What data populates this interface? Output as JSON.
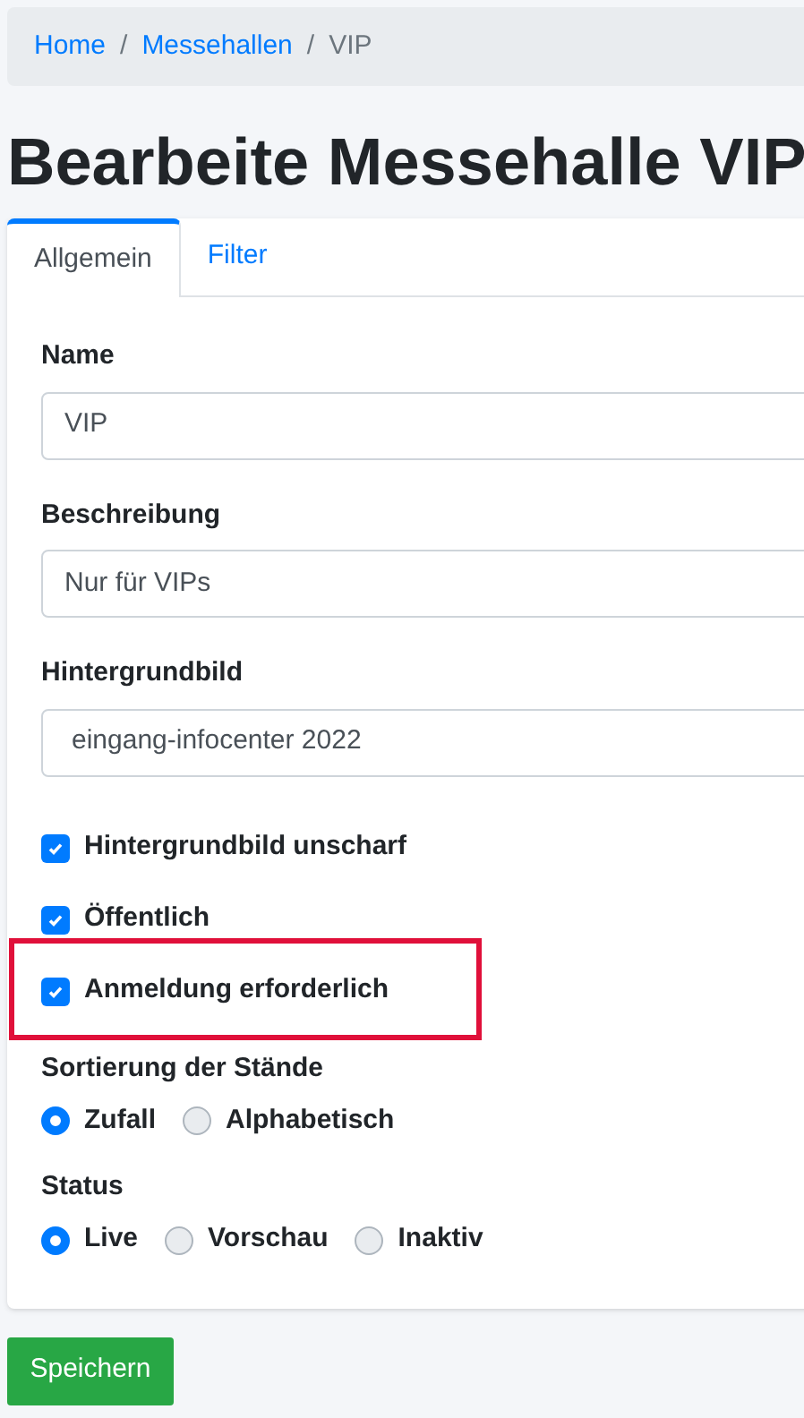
{
  "breadcrumb": {
    "separators": [
      "/",
      "/"
    ],
    "items": [
      {
        "label": "Home",
        "link": true
      },
      {
        "label": "Messehallen",
        "link": true
      },
      {
        "label": "VIP",
        "link": false
      }
    ]
  },
  "title": "Bearbeite Messehalle VIP",
  "tabs": [
    {
      "label": "Allgemein",
      "selected": true
    },
    {
      "label": "Filter",
      "selected": false
    }
  ],
  "fields": [
    {
      "label": "Name",
      "value": "VIP"
    },
    {
      "label": "Beschreibung",
      "value": "Nur für VIPs"
    },
    {
      "label": "Hintergrundbild",
      "value": "eingang-infocenter 2022",
      "kind": "select"
    }
  ],
  "checkboxes": [
    {
      "label": "Hintergrundbild unscharf",
      "checked": true,
      "highlighted": false
    },
    {
      "label": "Öffentlich",
      "checked": true,
      "highlighted": false
    },
    {
      "label": "Anmeldung erforderlich",
      "checked": true,
      "highlighted": true
    }
  ],
  "radio_groups": [
    {
      "label": "Sortierung der Stände",
      "options": [
        {
          "label": "Zufall",
          "selected": true
        },
        {
          "label": "Alphabetisch",
          "selected": false
        }
      ]
    },
    {
      "label": "Status",
      "options": [
        {
          "label": "Live",
          "selected": true
        },
        {
          "label": "Vorschau",
          "selected": false
        },
        {
          "label": "Inaktiv",
          "selected": false
        }
      ]
    }
  ],
  "save_button": "Speichern"
}
